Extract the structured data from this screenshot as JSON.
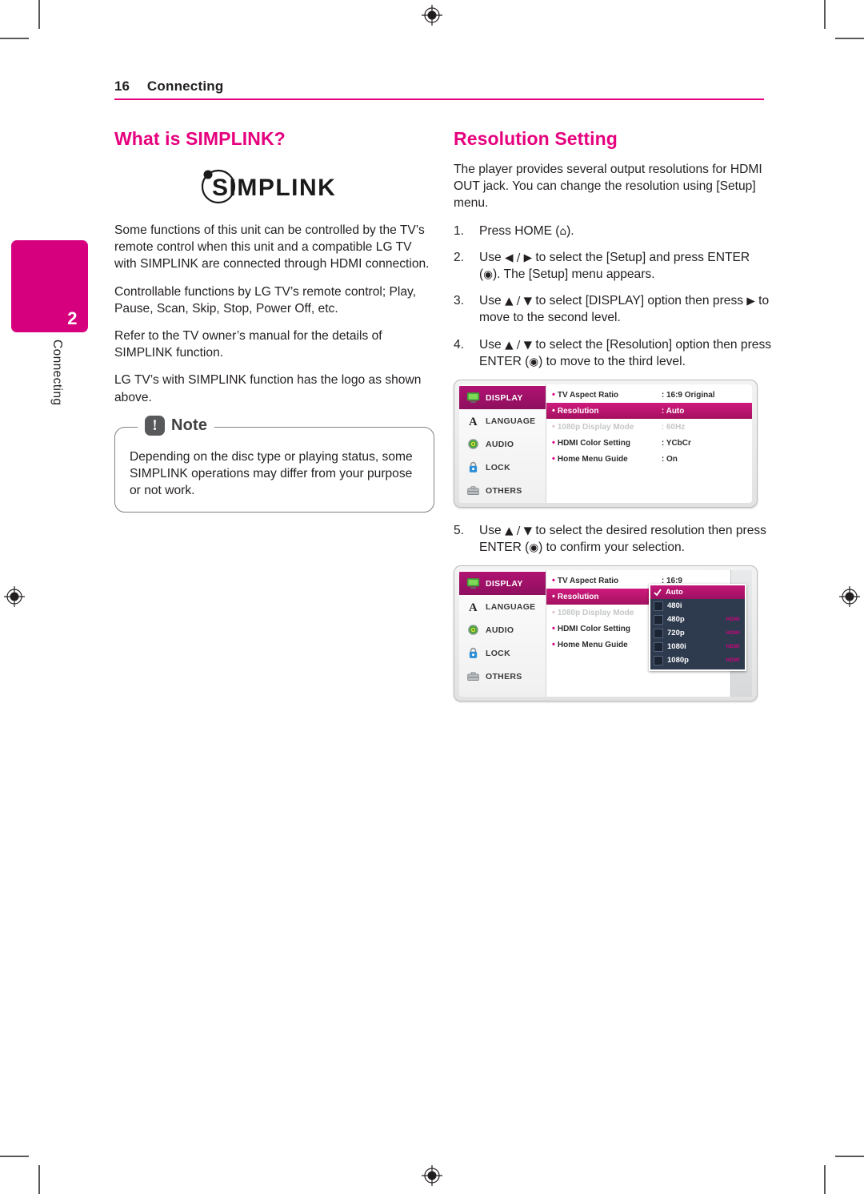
{
  "page": {
    "number": "16",
    "running_head": "Connecting",
    "chapter_number": "2",
    "chapter_name": "Connecting",
    "accent_color": "#e6007e",
    "tab_color": "#d6007f"
  },
  "left_column": {
    "heading": "What is SIMPLINK?",
    "logo_text": "SIMPLINK",
    "paragraphs": [
      "Some functions of this unit can be controlled by the TV’s remote control when this unit and a compatible LG TV with SIMPLINK are connected through HDMI connection.",
      "Controllable functions by LG TV’s remote control; Play, Pause, Scan, Skip, Stop, Power Off, etc.",
      "Refer to the TV owner’s manual for the details of SIMPLINK function.",
      "LG TV’s with SIMPLINK function has the logo as shown above."
    ],
    "note": {
      "badge": "!",
      "title": "Note",
      "text": "Depending on the disc type or playing status, some SIMPLINK operations may differ from your purpose or not work."
    }
  },
  "right_column": {
    "heading": "Resolution Setting",
    "intro": "The player provides several output resolutions for HDMI OUT jack. You can change the resolution using [Setup] menu.",
    "steps": [
      {
        "num": "1.",
        "parts": [
          {
            "t": "text",
            "v": "Press HOME ("
          },
          {
            "t": "icon",
            "v": "⌂"
          },
          {
            "t": "text",
            "v": ")."
          }
        ]
      },
      {
        "num": "2.",
        "parts": [
          {
            "t": "text",
            "v": "Use "
          },
          {
            "t": "icon",
            "v": "◀ / ▶"
          },
          {
            "t": "text",
            "v": " to select the [Setup] and press ENTER ("
          },
          {
            "t": "icon",
            "v": "◉"
          },
          {
            "t": "text",
            "v": "). The [Setup] menu appears."
          }
        ]
      },
      {
        "num": "3.",
        "parts": [
          {
            "t": "text",
            "v": "Use "
          },
          {
            "t": "icon",
            "v": "▲ / ▼"
          },
          {
            "t": "text",
            "v": " to select [DISPLAY] option then press "
          },
          {
            "t": "icon",
            "v": "▶"
          },
          {
            "t": "text",
            "v": " to move to the second level."
          }
        ]
      },
      {
        "num": "4.",
        "parts": [
          {
            "t": "text",
            "v": "Use "
          },
          {
            "t": "icon",
            "v": "▲ / ▼"
          },
          {
            "t": "text",
            "v": " to select the [Resolution] option then press ENTER ("
          },
          {
            "t": "icon",
            "v": "◉"
          },
          {
            "t": "text",
            "v": ") to move to the third level."
          }
        ]
      },
      {
        "num": "5.",
        "parts": [
          {
            "t": "text",
            "v": "Use "
          },
          {
            "t": "icon",
            "v": "▲ / ▼"
          },
          {
            "t": "text",
            "v": " to select the desired resolution then press ENTER ("
          },
          {
            "t": "icon",
            "v": "◉"
          },
          {
            "t": "text",
            "v": ") to confirm your selection."
          }
        ]
      }
    ]
  },
  "osd_menu": {
    "nav": [
      {
        "label": "DISPLAY",
        "icon": "tv-icon",
        "active": true
      },
      {
        "label": "LANGUAGE",
        "icon": "letter-a-icon",
        "active": false
      },
      {
        "label": "AUDIO",
        "icon": "disc-icon",
        "active": false
      },
      {
        "label": "LOCK",
        "icon": "padlock-icon",
        "active": false
      },
      {
        "label": "OTHERS",
        "icon": "briefcase-icon",
        "active": false
      }
    ],
    "rows": [
      {
        "label": "TV Aspect Ratio",
        "value": ": 16:9 Original",
        "state": "normal"
      },
      {
        "label": "Resolution",
        "value": ": Auto",
        "state": "selected"
      },
      {
        "label": "1080p Display Mode",
        "value": ": 60Hz",
        "state": "disabled"
      },
      {
        "label": "HDMI Color Setting",
        "value": ": YCbCr",
        "state": "normal"
      },
      {
        "label": "Home Menu Guide",
        "value": ": On",
        "state": "normal"
      }
    ],
    "rows_truncated": [
      {
        "label": "TV Aspect Ratio",
        "value": ": 16:9",
        "state": "normal"
      },
      {
        "label": "Resolution",
        "value": ": Auto",
        "state": "selected"
      },
      {
        "label": "1080p Display Mode",
        "value": ": 60Hz",
        "state": "disabled"
      },
      {
        "label": "HDMI Color Setting",
        "value": ": YCb",
        "state": "normal"
      },
      {
        "label": "Home Menu Guide",
        "value": ": On",
        "state": "normal"
      }
    ],
    "resolution_options": [
      {
        "label": "Auto",
        "hdmi": "",
        "selected": true
      },
      {
        "label": "480i",
        "hdmi": "",
        "selected": false
      },
      {
        "label": "480p",
        "hdmi": "HDMI",
        "selected": false
      },
      {
        "label": "720p",
        "hdmi": "HDMI",
        "selected": false
      },
      {
        "label": "1080i",
        "hdmi": "HDMI",
        "selected": false
      },
      {
        "label": "1080p",
        "hdmi": "HDMI",
        "selected": false
      }
    ]
  }
}
